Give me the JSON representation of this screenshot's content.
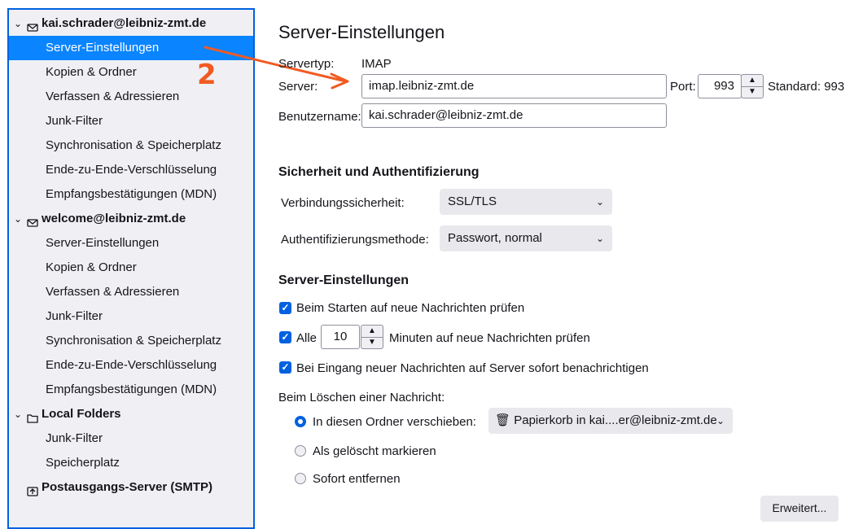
{
  "sidebar": {
    "accounts": [
      {
        "name": "kai.schrader@leibniz-zmt.de",
        "items": [
          "Server-Einstellungen",
          "Kopien & Ordner",
          "Verfassen & Adressieren",
          "Junk-Filter",
          "Synchronisation & Speicherplatz",
          "Ende-zu-Ende-Verschlüsselung",
          "Empfangsbestätigungen (MDN)"
        ]
      },
      {
        "name": "welcome@leibniz-zmt.de",
        "items": [
          "Server-Einstellungen",
          "Kopien & Ordner",
          "Verfassen & Adressieren",
          "Junk-Filter",
          "Synchronisation & Speicherplatz",
          "Ende-zu-Ende-Verschlüsselung",
          "Empfangsbestätigungen (MDN)"
        ]
      },
      {
        "name": "Local Folders",
        "items": [
          "Junk-Filter",
          "Speicherplatz"
        ]
      }
    ],
    "smtp": "Postausgangs-Server (SMTP)",
    "selected": "kai.schrader@leibniz-zmt.de / Server-Einstellungen"
  },
  "annotation": {
    "number": "2",
    "color": "#f15a22"
  },
  "main": {
    "title": "Server-Einstellungen",
    "servertype_label": "Servertyp:",
    "servertype_value": "IMAP",
    "server_label": "Server:",
    "server_value": "imap.leibniz-zmt.de",
    "port_label": "Port:",
    "port_value": "993",
    "port_default": "Standard: 993",
    "username_label": "Benutzername:",
    "username_value": "kai.schrader@leibniz-zmt.de",
    "security_heading": "Sicherheit und Authentifizierung",
    "conn_security_label": "Verbindungssicherheit:",
    "conn_security_value": "SSL/TLS",
    "auth_label": "Authentifizierungsmethode:",
    "auth_value": "Passwort, normal",
    "server_settings_heading": "Server-Einstellungen",
    "check_startup_label": "Beim Starten auf neue Nachrichten prüfen",
    "check_every_label": "Alle",
    "check_every_value": "10",
    "check_every_suffix": "Minuten auf neue Nachrichten prüfen",
    "notify_label": "Bei Eingang neuer Nachrichten auf Server sofort benachrichtigen",
    "delete_label": "Beim Löschen einer Nachricht:",
    "move_label": "In diesen Ordner verschieben:",
    "trash_value": "Papierkorb in kai....er@leibniz-zmt.de",
    "mark_deleted_label": "Als gelöscht markieren",
    "remove_label": "Sofort entfernen",
    "advanced_button": "Erweitert..."
  }
}
